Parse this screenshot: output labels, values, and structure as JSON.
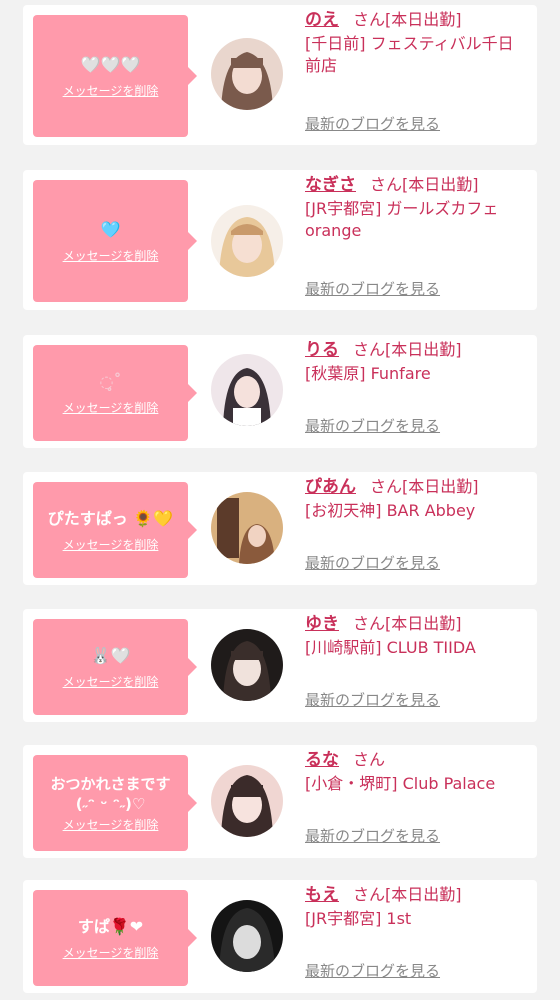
{
  "labels": {
    "delete": "メッセージを削除",
    "blog": "最新のブログを見る",
    "san": "さん"
  },
  "cards": [
    {
      "message": "🤍🤍🤍",
      "name": "のえ",
      "status": "[本日出勤]",
      "shop": "[千日前] フェスティバル千日前店",
      "avatar_colors": [
        "#e9d6cd",
        "#7a5a4c"
      ]
    },
    {
      "message": "🩵",
      "name": "なぎさ",
      "status": "[本日出勤]",
      "shop": "[JR宇都宮] ガールズカフェ orange",
      "avatar_colors": [
        "#f1d3b3",
        "#c99a6b"
      ]
    },
    {
      "message": "◌̥˚",
      "name": "りる",
      "status": "[本日出勤]",
      "shop": "[秋葉原] Funfare",
      "avatar_colors": [
        "#efe6ea",
        "#3a3138"
      ]
    },
    {
      "message": "ぴたすぱっ 🌻💛",
      "name": "ぴあん",
      "status": "[本日出勤]",
      "shop": "[お初天神] BAR Abbey",
      "avatar_colors": [
        "#d9b17f",
        "#5c3b2a"
      ]
    },
    {
      "message": "🐰🤍",
      "name": "ゆき",
      "status": "[本日出勤]",
      "shop": "[川崎駅前] CLUB TIIDA",
      "avatar_colors": [
        "#e6e1dc",
        "#1f1b1a"
      ]
    },
    {
      "message": "おつかれさまです\n(˶ᵔ ᵕ ᵔ˶)♡",
      "name": "るな",
      "status": "",
      "shop": "[小倉・堺町] Club Palace",
      "avatar_colors": [
        "#f0d6d2",
        "#3b2b2a"
      ]
    },
    {
      "message": "すぱ🌹❤",
      "name": "もえ",
      "status": "[本日出勤]",
      "shop": "[JR宇都宮] 1st",
      "avatar_colors": [
        "#cfcfcf",
        "#141414"
      ]
    }
  ]
}
